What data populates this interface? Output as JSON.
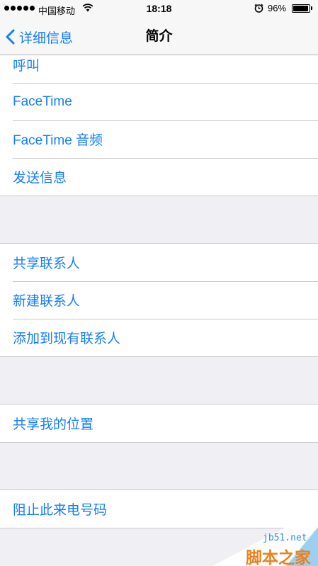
{
  "status_bar": {
    "carrier": "中国移动",
    "time": "18:18",
    "battery_percent": "96%",
    "battery_level": 0.96,
    "icons": [
      "signal-icon",
      "wifi-icon",
      "alarm-icon",
      "battery-icon"
    ]
  },
  "nav": {
    "back_label": "详细信息",
    "title": "简介"
  },
  "groups": {
    "actions": [
      "呼叫",
      "FaceTime",
      "FaceTime 音频",
      "发送信息"
    ],
    "contacts": [
      "共享联系人",
      "新建联系人",
      "添加到现有联系人"
    ],
    "location": [
      "共享我的位置"
    ],
    "block": [
      "阻止此来电号码"
    ]
  },
  "watermark": {
    "domain": "jb51.net",
    "name": "脚本之家"
  },
  "colors": {
    "accent": "#157efb",
    "background": "#efeff4",
    "bar": "#f7f7f7"
  }
}
